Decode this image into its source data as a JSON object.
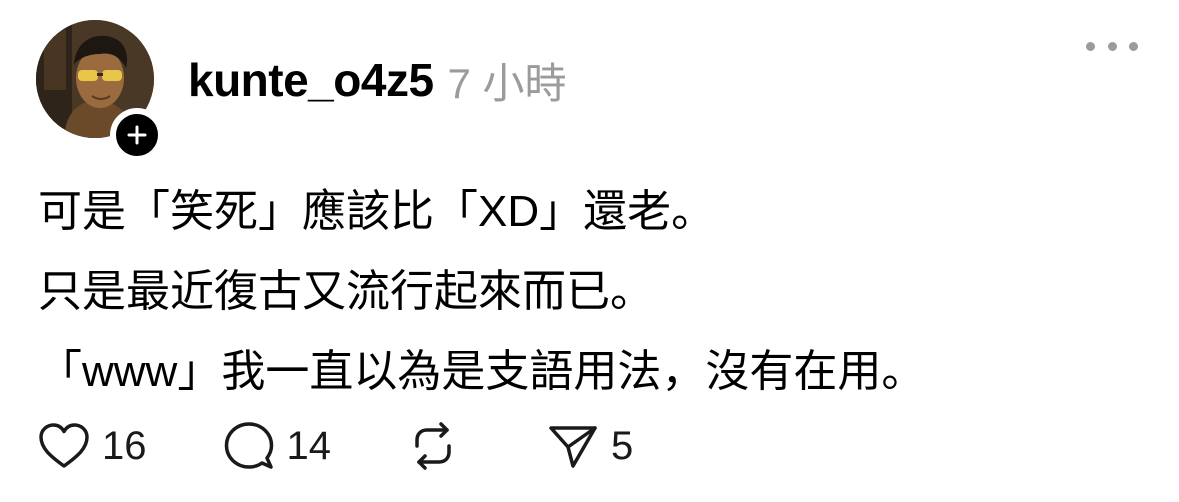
{
  "post": {
    "author": {
      "username": "kunte_o4z5",
      "avatar_icon": "avatar-photo",
      "follow_icon": "plus-icon"
    },
    "timestamp": "7 小時",
    "more_icon": "more-horizontal-icon",
    "body_lines": [
      "可是「笑死」應該比「XD」還老。",
      "只是最近復古又流行起來而已。",
      "「www」我一直以為是支語用法，沒有在用。"
    ],
    "actions": {
      "like": {
        "icon": "heart-icon",
        "count": "16"
      },
      "comment": {
        "icon": "comment-icon",
        "count": "14"
      },
      "repost": {
        "icon": "repost-icon",
        "count": ""
      },
      "share": {
        "icon": "send-icon",
        "count": "5"
      }
    }
  },
  "colors": {
    "text": "#000000",
    "muted": "#9b9b9b",
    "badge": "#000000",
    "background": "#ffffff"
  }
}
